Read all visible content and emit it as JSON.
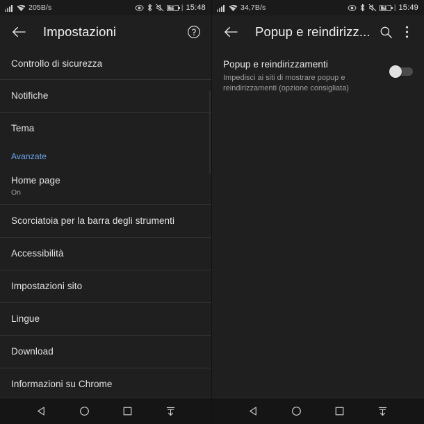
{
  "colors": {
    "background": "#1f1f1f",
    "statusbar_bg": "#1a1a1a",
    "navbar_bg": "#151515",
    "divider": "#333333",
    "primary_text": "#e3e3e3",
    "secondary_text": "#9aa0a6",
    "accent_blue": "#6ba9f0",
    "switch_knob": "#e0e0e0",
    "switch_track": "#4a4a4a"
  },
  "left_panel": {
    "statusbar": {
      "network_speed": "205B/s",
      "time": "15:48",
      "battery_percent": "57",
      "icons": [
        "signal-bars-icon",
        "wifi-icon",
        "eye-icon",
        "bluetooth-icon",
        "mute-icon",
        "battery-icon"
      ]
    },
    "appbar": {
      "back_label": "back-arrow",
      "title": "Impostazioni",
      "help_label": "?"
    },
    "items": [
      {
        "title": "Controllo di sicurezza",
        "subtitle": "",
        "type": "row"
      },
      {
        "title": "Notifiche",
        "subtitle": "",
        "type": "row"
      },
      {
        "title": "Tema",
        "subtitle": "",
        "type": "row"
      },
      {
        "title": "Avanzate",
        "subtitle": "",
        "type": "section"
      },
      {
        "title": "Home page",
        "subtitle": "On",
        "type": "row"
      },
      {
        "title": "Scorciatoia per la barra degli strumenti",
        "subtitle": "",
        "type": "row"
      },
      {
        "title": "Accessibilità",
        "subtitle": "",
        "type": "row"
      },
      {
        "title": "Impostazioni sito",
        "subtitle": "",
        "type": "row"
      },
      {
        "title": "Lingue",
        "subtitle": "",
        "type": "row"
      },
      {
        "title": "Download",
        "subtitle": "",
        "type": "row"
      },
      {
        "title": "Informazioni su Chrome",
        "subtitle": "",
        "type": "row"
      }
    ]
  },
  "right_panel": {
    "statusbar": {
      "network_speed": "34,7B/s",
      "time": "15:49",
      "battery_percent": "57",
      "icons": [
        "signal-bars-icon",
        "wifi-icon",
        "eye-icon",
        "bluetooth-icon",
        "mute-icon",
        "battery-icon"
      ]
    },
    "appbar": {
      "back_label": "back-arrow",
      "title": "Popup e reindirizz...",
      "search_label": "search",
      "overflow_label": "more-options"
    },
    "preference": {
      "title": "Popup e reindirizzamenti",
      "subtitle": "Impedisci ai siti di mostrare popup e reindirizzamenti (opzione consigliata)",
      "toggle_state": "off"
    }
  },
  "navbar": {
    "back": "back-triangle",
    "home": "home-circle",
    "recents": "recents-square",
    "hide": "hide-navbar-arrow"
  }
}
